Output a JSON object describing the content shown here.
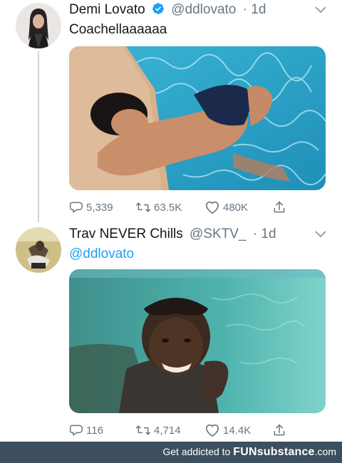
{
  "tweets": [
    {
      "name": "Demi Lovato",
      "verified": true,
      "handle": "@ddlovato",
      "time": "· 1d",
      "text": "Coachellaaaaaa",
      "stats": {
        "replies": "5,339",
        "retweets": "63.5K",
        "likes": "480K"
      }
    },
    {
      "name": "Trav NEVER Chills",
      "verified": false,
      "handle": "@SKTV_",
      "time": "· 1d",
      "text": "@ddlovato",
      "stats": {
        "replies": "116",
        "retweets": "4,714",
        "likes": "14.4K"
      }
    }
  ],
  "footer": {
    "prefix": "Get addicted to",
    "brand": "FUNsubstance",
    "suffix": ".com"
  },
  "colors": {
    "link": "#1da1f2",
    "muted": "#657786",
    "verified": "#1da1f2",
    "footer_bg": "#3d4f5f"
  },
  "icons": [
    "reply-icon",
    "retweet-icon",
    "like-icon",
    "share-icon",
    "verified-badge-icon",
    "chevron-down-icon"
  ]
}
